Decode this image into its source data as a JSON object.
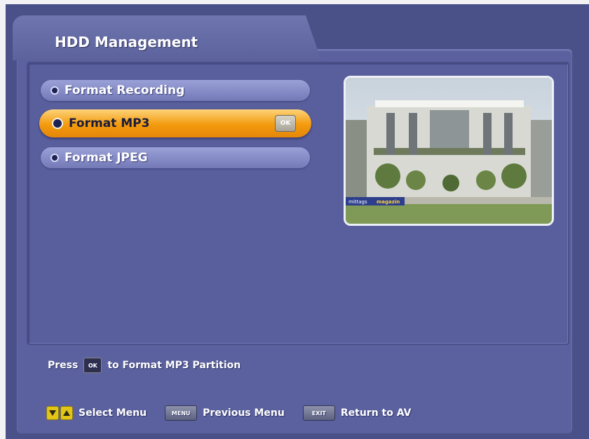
{
  "header": {
    "title": "HDD Management"
  },
  "menu": {
    "items": [
      {
        "label": "Format Recording",
        "active": false
      },
      {
        "label": "Format MP3",
        "active": true,
        "key": "OK"
      },
      {
        "label": "Format JPEG",
        "active": false
      }
    ]
  },
  "preview": {
    "banner_text_1": "mittags",
    "banner_text_2": "magazin"
  },
  "help": {
    "press": "Press",
    "key": "OK",
    "text": "to Format MP3 Partition"
  },
  "legend": {
    "select": "Select Menu",
    "menu_key": "MENU",
    "previous": "Previous Menu",
    "exit_key": "EXIT",
    "return": "Return to AV"
  },
  "colors": {
    "background": "#4a5088",
    "panel": "#5b619e",
    "highlight": "#f39a0d",
    "button_key": "#e3c519"
  }
}
